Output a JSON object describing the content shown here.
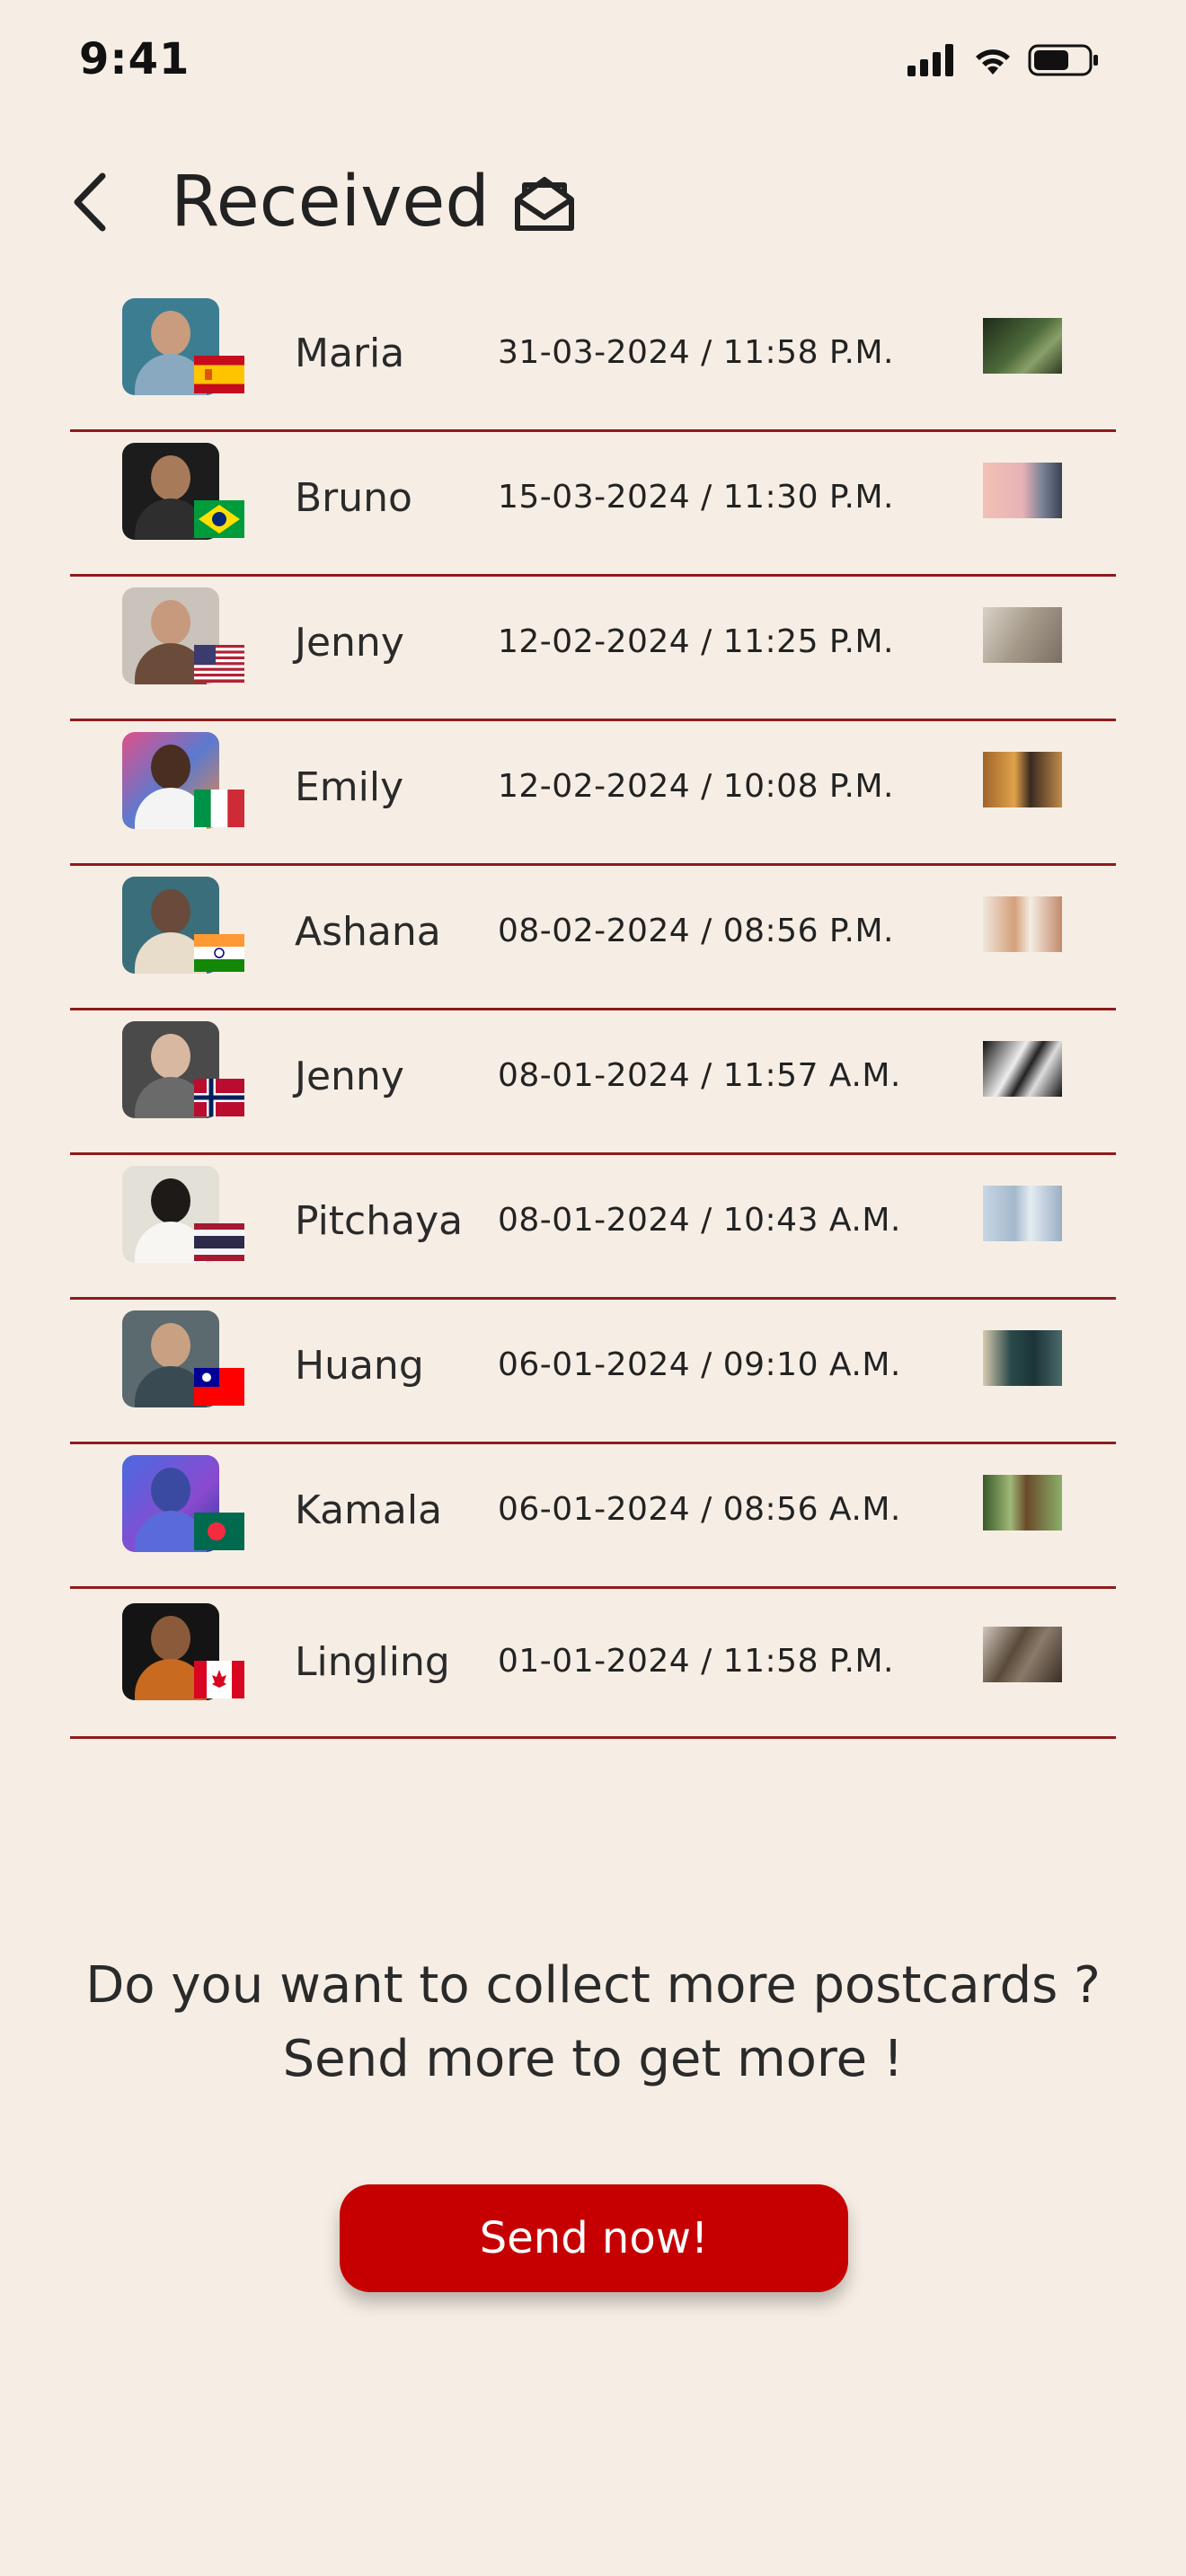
{
  "status": {
    "time": "9:41"
  },
  "header": {
    "title": "Received"
  },
  "items": [
    {
      "name": "Maria",
      "datetime": "31-03-2024 / 11:58 P.M.",
      "country": "Spain"
    },
    {
      "name": "Bruno",
      "datetime": "15-03-2024 / 11:30 P.M.",
      "country": "Brazil"
    },
    {
      "name": "Jenny",
      "datetime": "12-02-2024 / 11:25 P.M.",
      "country": "United States"
    },
    {
      "name": "Emily",
      "datetime": "12-02-2024 / 10:08 P.M.",
      "country": "Italy"
    },
    {
      "name": "Ashana",
      "datetime": "08-02-2024 / 08:56 P.M.",
      "country": "India"
    },
    {
      "name": "Jenny",
      "datetime": "08-01-2024 / 11:57 A.M.",
      "country": "Norway"
    },
    {
      "name": "Pitchaya",
      "datetime": "08-01-2024 / 10:43 A.M.",
      "country": "Thailand"
    },
    {
      "name": "Huang",
      "datetime": "06-01-2024 / 09:10 A.M.",
      "country": "Taiwan"
    },
    {
      "name": "Kamala",
      "datetime": "06-01-2024 / 08:56 A.M.",
      "country": "Bangladesh"
    },
    {
      "name": "Lingling",
      "datetime": "01-01-2024 / 11:58 P.M.",
      "country": "Canada"
    }
  ],
  "promo": {
    "line1": "Do you want to collect more postcards ?",
    "line2": "Send more to get more !"
  },
  "cta": {
    "label": "Send now!"
  },
  "colors": {
    "background": "#f6eee5",
    "accent": "#c60000",
    "divider": "#8e1b1b"
  }
}
